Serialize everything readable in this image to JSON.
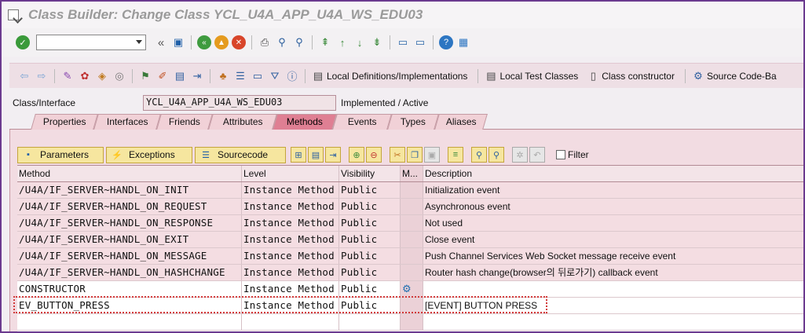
{
  "window": {
    "title": "Class Builder: Change Class YCL_U4A_APP_U4A_WS_EDU03"
  },
  "toolbar": {
    "command_field": "",
    "buttons": [
      "local-definitions",
      "local-test-classes",
      "class-constructor",
      "source-code-based"
    ],
    "local_defs_label": "Local Definitions/Implementations",
    "local_test_label": "Local Test Classes",
    "class_ctor_label": "Class constructor",
    "source_code_label": "Source Code-Ba"
  },
  "class_row": {
    "label": "Class/Interface",
    "value": "YCL_U4A_APP_U4A_WS_EDU03",
    "status": "Implemented / Active"
  },
  "tabs": [
    "Properties",
    "Interfaces",
    "Friends",
    "Attributes",
    "Methods",
    "Events",
    "Types",
    "Aliases"
  ],
  "active_tab": "Methods",
  "methods_toolbar": {
    "parameters": "Parameters",
    "exceptions": "Exceptions",
    "sourcecode": "Sourcecode",
    "filter": "Filter"
  },
  "table": {
    "headers": [
      "Method",
      "Level",
      "Visibility",
      "M...",
      "Description"
    ],
    "rows": [
      {
        "method": "/U4A/IF_SERVER~HANDL_ON_INIT",
        "level": "Instance Method",
        "visibility": "Public",
        "m": "",
        "description": "Initialization event"
      },
      {
        "method": "/U4A/IF_SERVER~HANDL_ON_REQUEST",
        "level": "Instance Method",
        "visibility": "Public",
        "m": "",
        "description": "Asynchronous event"
      },
      {
        "method": "/U4A/IF_SERVER~HANDL_ON_RESPONSE",
        "level": "Instance Method",
        "visibility": "Public",
        "m": "",
        "description": "Not used"
      },
      {
        "method": "/U4A/IF_SERVER~HANDL_ON_EXIT",
        "level": "Instance Method",
        "visibility": "Public",
        "m": "",
        "description": "Close event"
      },
      {
        "method": "/U4A/IF_SERVER~HANDL_ON_MESSAGE",
        "level": "Instance Method",
        "visibility": "Public",
        "m": "",
        "description": "Push Channel Services Web Socket message receive event"
      },
      {
        "method": "/U4A/IF_SERVER~HANDL_ON_HASHCHANGE",
        "level": "Instance Method",
        "visibility": "Public",
        "m": "",
        "description": "Router hash change(browser의 뒤로가기) callback event"
      },
      {
        "method": "CONSTRUCTOR",
        "level": "Instance Method",
        "visibility": "Public",
        "m": "",
        "description": ""
      },
      {
        "method": "EV_BUTTON_PRESS",
        "level": "Instance Method",
        "visibility": "Public",
        "m": "",
        "description": "[EVENT] BUTTON PRESS"
      }
    ]
  },
  "colors": {
    "accent": "#df7f93",
    "highlight": "#d23a3a",
    "frame": "#6b3a8f"
  }
}
